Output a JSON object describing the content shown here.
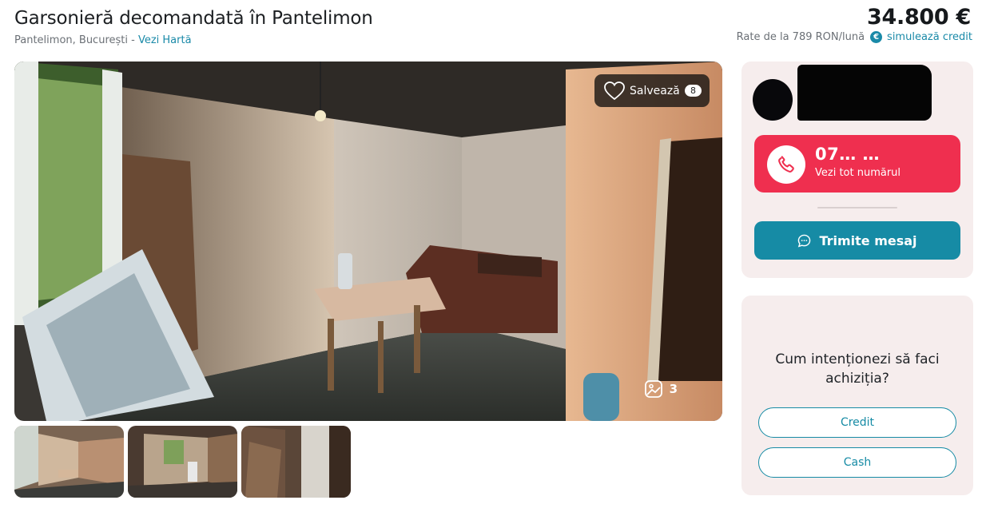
{
  "listing": {
    "title": "Garsonieră decomandată în Pantelimon",
    "location": "Pantelimon, București - ",
    "map_link": "Vezi Hartă",
    "price": "34.800 €",
    "rates_text": "Rate de la 789 RON/lună",
    "rates_icon": "euro-icon",
    "simulate_link": "simulează credit"
  },
  "gallery": {
    "save_label": "Salvează",
    "save_count": "8",
    "photo_count": "3",
    "thumbnails": 3
  },
  "contact": {
    "phone_masked": "07… …",
    "phone_reveal": "Vezi tot numărul",
    "message_label": "Trimite mesaj"
  },
  "purchase": {
    "question": "Cum intenționezi să faci achiziția?",
    "option_credit": "Credit",
    "option_cash": "Cash"
  },
  "colors": {
    "accent": "#168ba5",
    "phone": "#ef2f4f",
    "card_bg": "#f6eded"
  }
}
